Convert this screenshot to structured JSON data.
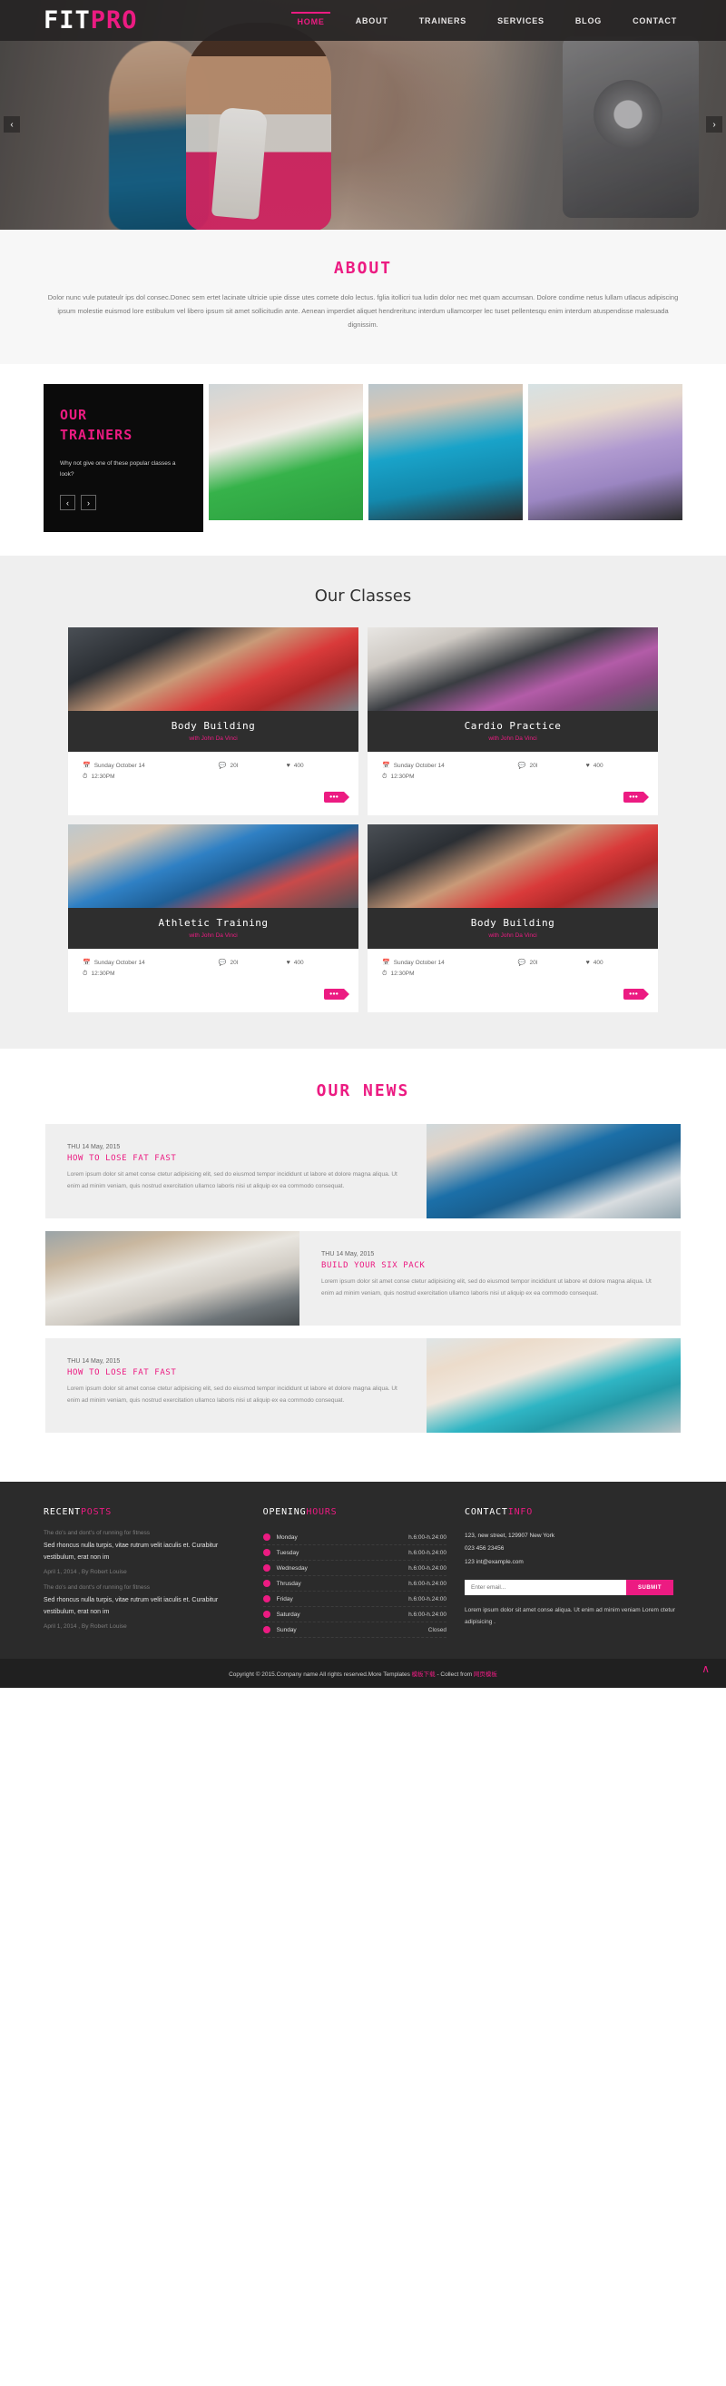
{
  "header": {
    "logo_white": "FIT",
    "logo_pink": "PRO",
    "nav": [
      {
        "label": "HOME",
        "active": true
      },
      {
        "label": "ABOUT",
        "active": false
      },
      {
        "label": "TRAINERS",
        "active": false
      },
      {
        "label": "SERVICES",
        "active": false
      },
      {
        "label": "BLOG",
        "active": false
      },
      {
        "label": "CONTACT",
        "active": false
      }
    ],
    "slider_prev": "‹",
    "slider_next": "›"
  },
  "about": {
    "title": "ABOUT",
    "body": "Dolor nunc vule putateulr ips dol consec.Donec sem ertet lacinate ultricie upie disse utes comete dolo lectus. fglia itollicri tua ludin dolor nec met quam accumsan. Dolore condime netus lullam utlacus adipiscing ipsum molestie euismod lore estibulum vel libero ipsum sit amet sollicitudin ante. Aenean imperdiet aliquet hendreritunc interdum ullamcorper lec tuset pellentesqu enim interdum atuspendisse malesuada dignissim."
  },
  "trainers": {
    "title_line1": "OUR",
    "title_line2": "TRAINERS",
    "subtitle": "Why not give one of these popular classes a look?",
    "prev": "‹",
    "next": "›"
  },
  "classes": {
    "title": "Our Classes",
    "items": [
      {
        "name": "Body Building",
        "instructor": "with John Da Vinci",
        "date": "Sunday October 14",
        "time": "12:30PM",
        "comments": "20l",
        "likes": "400",
        "tag": "●●●"
      },
      {
        "name": "Cardio Practice",
        "instructor": "with John Da Vinci",
        "date": "Sunday October 14",
        "time": "12:30PM",
        "comments": "20l",
        "likes": "400",
        "tag": "●●●"
      },
      {
        "name": "Athletic Training",
        "instructor": "with John Da Vinci",
        "date": "Sunday October 14",
        "time": "12:30PM",
        "comments": "20l",
        "likes": "400",
        "tag": "●●●"
      },
      {
        "name": "Body Building",
        "instructor": "with John Da Vinci",
        "date": "Sunday October 14",
        "time": "12:30PM",
        "comments": "20l",
        "likes": "400",
        "tag": "●●●"
      }
    ],
    "icons": {
      "date": "Ὄ5",
      "time": "◴",
      "comment": "●",
      "like": "♥"
    }
  },
  "news": {
    "title": "OUR NEWS",
    "items": [
      {
        "date": "THU 14 May, 2015",
        "headline": "HOW TO LOSE FAT FAST",
        "body": "Lorem ipsum dolor sit amet conse ctetur adipisicing elit, sed do eiusmod tempor incididunt ut labore et dolore magna aliqua. Ut enim ad minim veniam, quis nostrud exercitation ullamco laboris nisi ut aliquip ex ea commodo consequat.",
        "image_side": "right"
      },
      {
        "date": "THU 14 May, 2015",
        "headline": "BUILD YOUR SIX PACK",
        "body": "Lorem ipsum dolor sit amet conse ctetur adipisicing elit, sed do eiusmod tempor incididunt ut labore et dolore magna aliqua. Ut enim ad minim veniam, quis nostrud exercitation ullamco laboris nisi ut aliquip ex ea commodo consequat.",
        "image_side": "left"
      },
      {
        "date": "THU 14 May, 2015",
        "headline": "HOW TO LOSE FAT FAST",
        "body": "Lorem ipsum dolor sit amet conse ctetur adipisicing elit, sed do eiusmod tempor incididunt ut labore et dolore magna aliqua. Ut enim ad minim veniam, quis nostrud exercitation ullamco laboris nisi ut aliquip ex ea commodo consequat.",
        "image_side": "right"
      }
    ]
  },
  "footer": {
    "recent": {
      "title_white": "RECENT",
      "title_pink": "POSTS",
      "posts": [
        {
          "teaser": "The do's and dont's of running for fitness",
          "body": "Sed rhoncus nulla turpis, vitae rutrum velit iaculis et. Curabitur vestibulum, erat non im",
          "meta": "April 1, 2014 , By Robert Louise"
        },
        {
          "teaser": "The do's and dont's of running for fitness",
          "body": "Sed rhoncus nulla turpis, vitae rutrum velit iaculis et. Curabitur vestibulum, erat non im",
          "meta": "April 1, 2014 , By Robert Louise"
        }
      ]
    },
    "hours": {
      "title_white": "OPENING",
      "title_pink": "HOURS",
      "rows": [
        {
          "day": "Monday",
          "time": "h.6:00-h.24:00"
        },
        {
          "day": "Tuesday",
          "time": "h.6:00-h.24:00"
        },
        {
          "day": "Wednesday",
          "time": "h.6:00-h.24:00"
        },
        {
          "day": "Thrusday",
          "time": "h.6:00-h.24:00"
        },
        {
          "day": "Friday",
          "time": "h.6:00-h.24:00"
        },
        {
          "day": "Saturday",
          "time": "h.6:00-h.24:00"
        },
        {
          "day": "Sunday",
          "time": "Closed"
        }
      ]
    },
    "contact": {
      "title_white": "CONTACT",
      "title_pink": "INFO",
      "address": "123, new street, 129907 New York",
      "phone": "023 456 23456",
      "email": "123 int@example.com",
      "newsletter_placeholder": "Enter email...",
      "newsletter_button": "SUBMIT",
      "note": "Lorem ipsum dolor sit amet conse aliqua. Ut enim ad minim veniam Lorem ctetur adipisicing ."
    },
    "copyright_prefix": "Copyright © 2015.Company name All rights reserved.More Templates ",
    "copyright_link1": "模板下载",
    "copyright_mid": " - Collect from ",
    "copyright_link2": "网页模板",
    "totop": "∧"
  }
}
